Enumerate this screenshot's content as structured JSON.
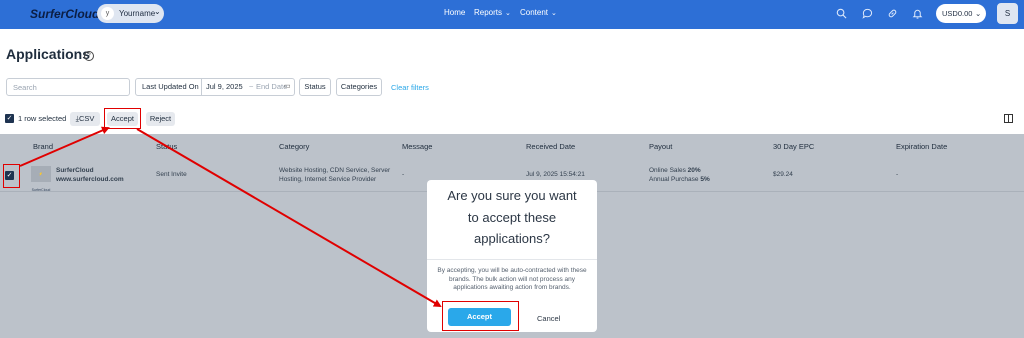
{
  "header": {
    "logo": "SurferCloud",
    "user_initial": "y",
    "user_name": "Yourname",
    "nav": [
      {
        "label": "Home"
      },
      {
        "label": "Reports"
      },
      {
        "label": "Content"
      }
    ],
    "balance": "USD0.00",
    "avatar_initial": "S",
    "color": "#2d6fd6"
  },
  "page": {
    "title": "Applications",
    "help": "?"
  },
  "filters": {
    "search_placeholder": "Search",
    "last_updated_label": "Last Updated On",
    "date_start": "Jul 9, 2025",
    "date_separator": "~",
    "date_end_placeholder": "End Date",
    "status_label": "Status",
    "categories_label": "Categories",
    "clear_label": "Clear filters"
  },
  "actions": {
    "selected_text": "1 row selected",
    "csv_label": "CSV",
    "accept_label": "Accept",
    "reject_label": "Reject"
  },
  "table": {
    "columns": [
      "Brand",
      "Status",
      "Category",
      "Message",
      "Received Date",
      "Payout",
      "30 Day EPC",
      "Expiration Date"
    ],
    "rows": [
      {
        "brand_logo_text": "⚡ SurferCloud",
        "brand_name": "SurferCloud",
        "brand_url": "www.surfercloud.com",
        "status": "Sent Invite",
        "category_line1": "Website Hosting, CDN Service, Server",
        "category_line2": "Hosting, Internet Service Provider",
        "message": "-",
        "received_date": "Jul 9, 2025 15:54:21",
        "payout_label1": "Online Sales",
        "payout_value1": "20%",
        "payout_label2": "Annual Purchase",
        "payout_value2": "5%",
        "epc": "$29.24",
        "expiration": "-"
      }
    ]
  },
  "modal": {
    "title_line1": "Are you sure you want",
    "title_line2": "to accept these",
    "title_line3": "applications?",
    "body": "By accepting, you will be auto-contracted with these brands. The bulk action will not process any applications awaiting action from brands.",
    "accept_label": "Accept",
    "cancel_label": "Cancel",
    "accent": "#2aa8ea"
  },
  "annotation": {
    "color": "#e00000"
  }
}
